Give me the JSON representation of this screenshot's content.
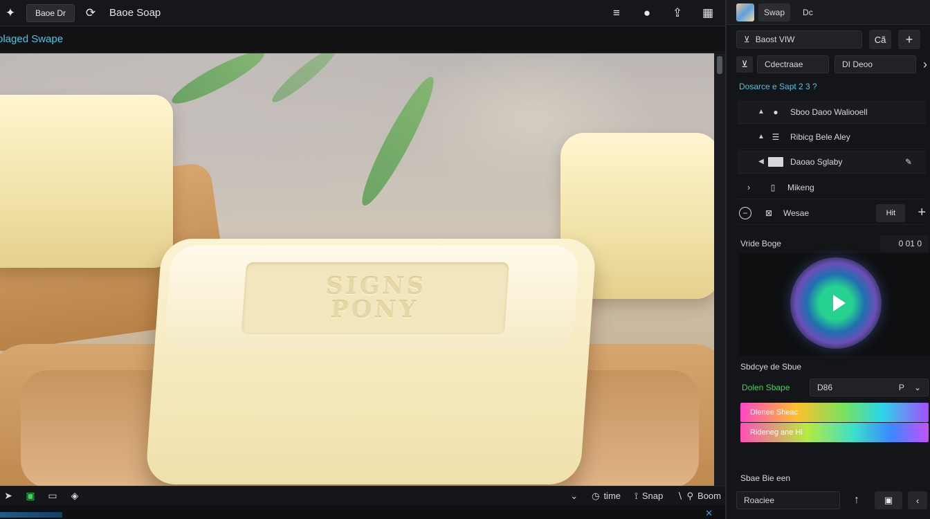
{
  "topbar": {
    "file_label": "Baoe Dr",
    "doc_title": "Baoe Soap",
    "icons": [
      "sparkle-icon",
      "sync-icon",
      "menu-icon",
      "pin-icon",
      "upload-icon",
      "grid-icon"
    ]
  },
  "subbar": {
    "label": "olaged Swape"
  },
  "canvas": {
    "emboss_line1": "SIGNS",
    "emboss_line2": "PONY"
  },
  "bottombar": {
    "time_label": "time",
    "snap_label": "Snap",
    "zoom_label": "Boom"
  },
  "panel": {
    "top_chip": "Swap",
    "top_plain": "Dc",
    "search_value": "Baost VIW",
    "search_btn": "Cã",
    "search_add": "+",
    "select_left": "Cdectraae",
    "select_right": "DI Deoo",
    "section_title": "Dosarce e Sapt 2 3 ?",
    "layers": [
      {
        "label": "Sboo Daoo Waliooell",
        "caret": "▲"
      },
      {
        "label": "Ribicg Bele Aley",
        "caret": "▲"
      },
      {
        "label": "Daoao Sglaby",
        "caret": "◀"
      },
      {
        "label": "Mikeng",
        "caret": "›"
      },
      {
        "label": "Wesae",
        "caret": ""
      }
    ],
    "layer_btn": "Hit",
    "add_label": "+",
    "preview_title": "Vride Boge",
    "preview_value": "0 01 0",
    "color_title": "Sbdcye de Sbue",
    "color_label": "Dolen Sbape",
    "color_value": "D86",
    "color_btn": "P",
    "gradient1_label": "Dlenee Sheac",
    "gradient2_label": "Rideneg ane Hi",
    "footer_title": "Sbae Bie een",
    "footer_field": "Roaciee",
    "accent_color": "#44c7e6",
    "green_color": "#3fd35a"
  }
}
